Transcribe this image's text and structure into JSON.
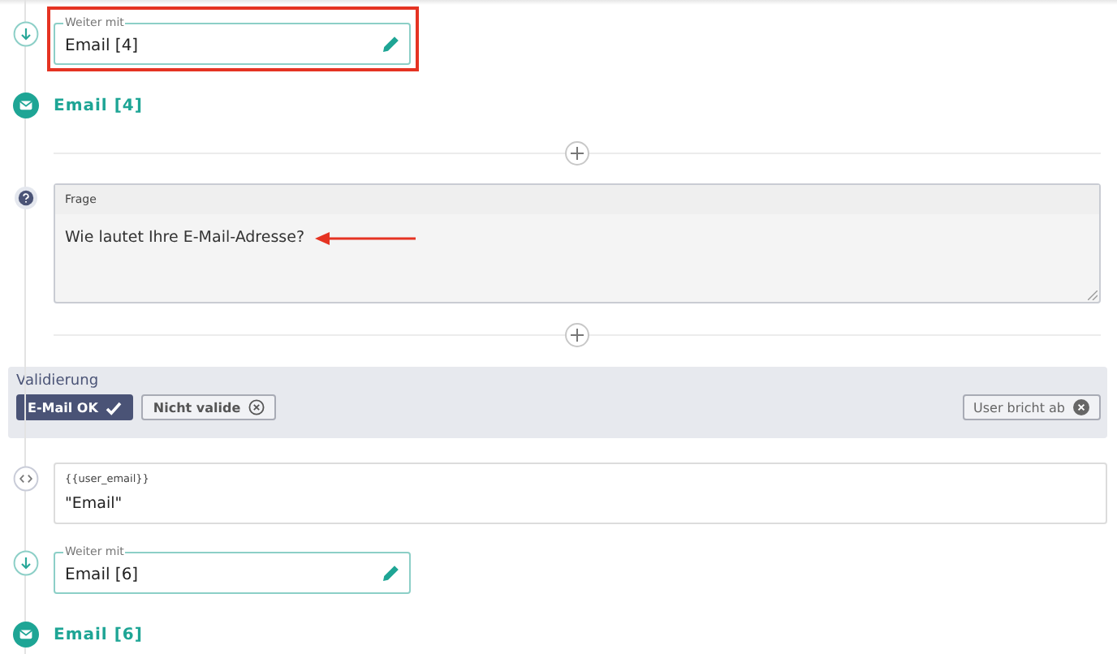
{
  "blocks": [
    {
      "kind": "goto",
      "legend": "Weiter mit",
      "value": "Email [4]",
      "highlighted": true
    },
    {
      "kind": "email",
      "title": "Email [4]"
    },
    {
      "kind": "add"
    },
    {
      "kind": "question",
      "label": "Frage",
      "text": "Wie lautet Ihre E-Mail-Adresse?",
      "arrow": true
    },
    {
      "kind": "add"
    },
    {
      "kind": "validation",
      "title": "Validierung",
      "options": [
        {
          "label": "E-Mail OK",
          "selected": true,
          "kind": "check"
        },
        {
          "label": "Nicht valide",
          "selected": false,
          "kind": "cross"
        }
      ],
      "abort": "User bricht ab"
    },
    {
      "kind": "variable",
      "name": "{{user_email}}",
      "value": "\"Email\""
    },
    {
      "kind": "goto",
      "legend": "Weiter mit",
      "value": "Email [6]",
      "highlighted": false
    },
    {
      "kind": "email",
      "title": "Email [6]"
    }
  ]
}
